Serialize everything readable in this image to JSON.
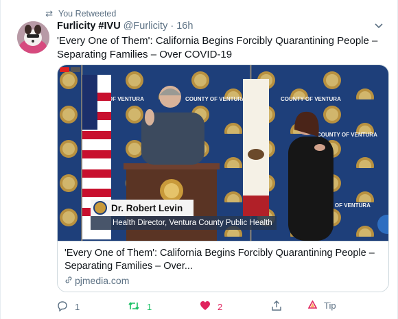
{
  "retweet": {
    "label": "You Retweeted"
  },
  "author": {
    "name": "Furlicity #IVU",
    "handle": "@Furlicity",
    "separator": "·",
    "time": "16h"
  },
  "tweet": {
    "text": "'Every One of Them': California Begins Forcibly Quarantining People – Separating Families – Over COVID-19"
  },
  "card": {
    "video": {
      "backdrop_text": "COUNTY OF VENTURA",
      "speaker_name": "Dr. Robert Levin",
      "speaker_title": "Health Director, Ventura County Public Health"
    },
    "title": "'Every One of Them': California Begins Forcibly Quarantining People – Separating Families – Over...",
    "domain": "pjmedia.com"
  },
  "actions": {
    "reply_count": "1",
    "retweet_count": "1",
    "like_count": "2",
    "tip_label": "Tip"
  },
  "colors": {
    "retweet_green": "#17bf63",
    "like_red": "#e0245e",
    "muted": "#5b7083",
    "backdrop_blue": "#1e3f7a"
  },
  "icons": [
    "retweet-icon",
    "chevron-down-icon",
    "reply-icon",
    "like-icon",
    "share-icon",
    "tip-icon",
    "link-icon"
  ]
}
